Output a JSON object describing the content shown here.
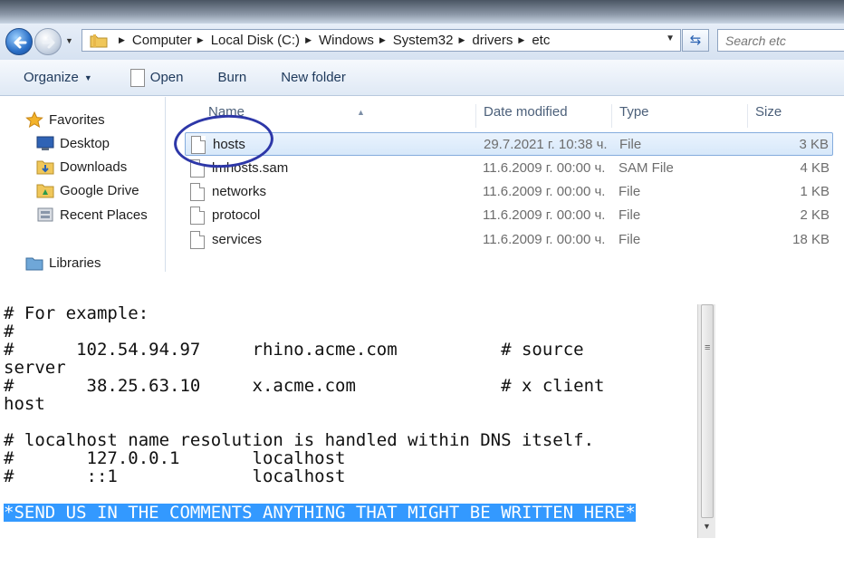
{
  "explorer": {
    "breadcrumb": [
      "Computer",
      "Local Disk (C:)",
      "Windows",
      "System32",
      "drivers",
      "etc"
    ],
    "search_placeholder": "Search etc",
    "toolbar": {
      "organize": "Organize",
      "open": "Open",
      "burn": "Burn",
      "new_folder": "New folder"
    },
    "nav": {
      "favorites": "Favorites",
      "desktop": "Desktop",
      "downloads": "Downloads",
      "google_drive": "Google Drive",
      "recent_places": "Recent Places",
      "libraries": "Libraries"
    },
    "columns": {
      "name": "Name",
      "date_modified": "Date modified",
      "type": "Type",
      "size": "Size"
    },
    "files": [
      {
        "name": "hosts",
        "date": "29.7.2021 г. 10:38 ч.",
        "type": "File",
        "size": "3 KB",
        "selected": true
      },
      {
        "name": "lmhosts.sam",
        "date": "11.6.2009 г. 00:00 ч.",
        "type": "SAM File",
        "size": "4 KB"
      },
      {
        "name": "networks",
        "date": "11.6.2009 г. 00:00 ч.",
        "type": "File",
        "size": "1 KB"
      },
      {
        "name": "protocol",
        "date": "11.6.2009 г. 00:00 ч.",
        "type": "File",
        "size": "2 KB"
      },
      {
        "name": "services",
        "date": "11.6.2009 г. 00:00 ч.",
        "type": "File",
        "size": "18 KB"
      }
    ]
  },
  "notepad": {
    "lines": [
      "# For example:",
      "#",
      "#      102.54.94.97     rhino.acme.com          # source",
      "server",
      "#       38.25.63.10     x.acme.com              # x client",
      "host",
      "",
      "# localhost name resolution is handled within DNS itself.",
      "#       127.0.0.1       localhost",
      "#       ::1             localhost",
      "",
      "*SEND US IN THE COMMENTS ANYTHING THAT MIGHT BE WRITTEN HERE*"
    ]
  },
  "colors": {
    "selection": "#3399ff",
    "annotation_circle": "#2d37a8",
    "toolbar_text": "#1e395b"
  }
}
